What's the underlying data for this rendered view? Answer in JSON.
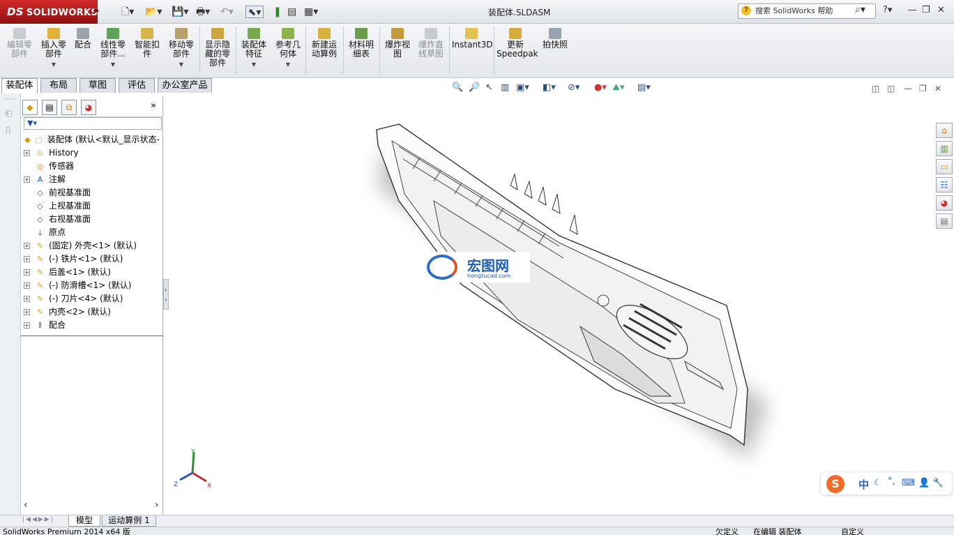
{
  "app": {
    "logo_text": "SOLIDWORKS",
    "logo_prefix": "DS",
    "doc_title": "装配体.SLDASM",
    "help_search_placeholder": "搜索 SolidWorks 帮助"
  },
  "commands": {
    "edit_component": "编辑零部件",
    "insert_component": "插入零部件",
    "mate": "配合",
    "linear_pattern": "线性零部件...",
    "smart_fasteners": "智能扣件",
    "move_component": "移动零部件",
    "show_hidden": "显示隐藏的零部件",
    "assembly_features": "装配体特征",
    "reference_geometry": "参考几何体",
    "new_motion_study": "新建运动算例",
    "bom": "材料明细表",
    "exploded_view": "爆炸视图",
    "explode_line_sketch": "爆炸直线草图",
    "instant3d": "Instant3D",
    "update_speedpak": "更新Speedpak",
    "take_snapshot": "拍快照"
  },
  "tabs": [
    "装配体",
    "布局",
    "草图",
    "评估",
    "办公室产品"
  ],
  "feature_tree": {
    "root": "装配体 (默认<默认_显示状态-",
    "items": [
      {
        "label": "History",
        "expandable": true,
        "icon": "history-icon"
      },
      {
        "label": "传感器",
        "expandable": false,
        "icon": "sensor-icon"
      },
      {
        "label": "注解",
        "expandable": true,
        "icon": "annotation-icon"
      },
      {
        "label": "前视基准面",
        "expandable": false,
        "icon": "plane-icon"
      },
      {
        "label": "上视基准面",
        "expandable": false,
        "icon": "plane-icon"
      },
      {
        "label": "右视基准面",
        "expandable": false,
        "icon": "plane-icon"
      },
      {
        "label": "原点",
        "expandable": false,
        "icon": "origin-icon"
      },
      {
        "label": "(固定) 外壳<1> (默认)",
        "expandable": true,
        "icon": "part-icon"
      },
      {
        "label": "(-) 铁片<1> (默认)",
        "expandable": true,
        "icon": "part-icon"
      },
      {
        "label": "后盖<1> (默认)",
        "expandable": true,
        "icon": "part-icon"
      },
      {
        "label": "(-) 防滑槽<1> (默认)",
        "expandable": true,
        "icon": "part-icon"
      },
      {
        "label": "(-) 刀片<4> (默认)",
        "expandable": true,
        "icon": "part-icon"
      },
      {
        "label": "内壳<2> (默认)",
        "expandable": true,
        "icon": "part-icon"
      },
      {
        "label": "配合",
        "expandable": true,
        "icon": "mates-icon"
      }
    ]
  },
  "bottom_tabs": [
    "模型",
    "运动算例 1"
  ],
  "status": {
    "product": "SolidWorks Premium 2014 x64 版",
    "underdefined": "欠定义",
    "editing": "在编辑 装配体",
    "custom": "自定义"
  },
  "watermark": {
    "name": "宏图网",
    "url": "hongtucad.com"
  },
  "triad": {
    "x": "X",
    "y": "Y",
    "z": "Z"
  },
  "ime": {
    "mode": "中"
  }
}
